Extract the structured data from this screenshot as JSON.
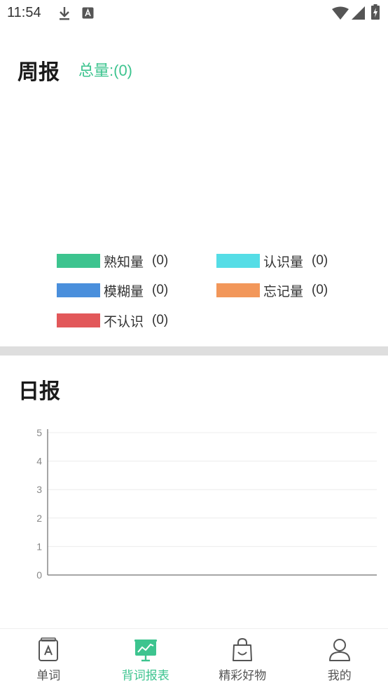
{
  "status_bar": {
    "time": "11:54",
    "icons": [
      "download-icon",
      "a-notification-icon",
      "wifi-icon",
      "signal-icon",
      "battery-charging-icon"
    ]
  },
  "weekly": {
    "title": "周报",
    "total": "总量:(0)",
    "legend": [
      {
        "label": "熟知量",
        "count": "(0)",
        "color": "#3dc48f"
      },
      {
        "label": "认识量",
        "count": "(0)",
        "color": "#55dde6"
      },
      {
        "label": "模糊量",
        "count": "(0)",
        "color": "#4a8fdc"
      },
      {
        "label": "忘记量",
        "count": "(0)",
        "color": "#f2975a"
      },
      {
        "label": "不认识",
        "count": "(0)",
        "color": "#e2585a"
      }
    ]
  },
  "daily": {
    "title": "日报"
  },
  "chart_data": {
    "type": "line",
    "title": "",
    "xlabel": "",
    "ylabel": "",
    "ylim": [
      0,
      5
    ],
    "yticks": [
      "0",
      "1",
      "2",
      "3",
      "4",
      "5"
    ],
    "series": [],
    "grid": true
  },
  "bottom_nav": {
    "items": [
      {
        "label": "单词",
        "icon": "book-icon",
        "active": false
      },
      {
        "label": "背词报表",
        "icon": "chart-board-icon",
        "active": true
      },
      {
        "label": "精彩好物",
        "icon": "shopping-bag-icon",
        "active": false
      },
      {
        "label": "我的",
        "icon": "person-icon",
        "active": false
      }
    ]
  },
  "colors": {
    "accent": "#3dc48f",
    "divider": "#dedede"
  }
}
